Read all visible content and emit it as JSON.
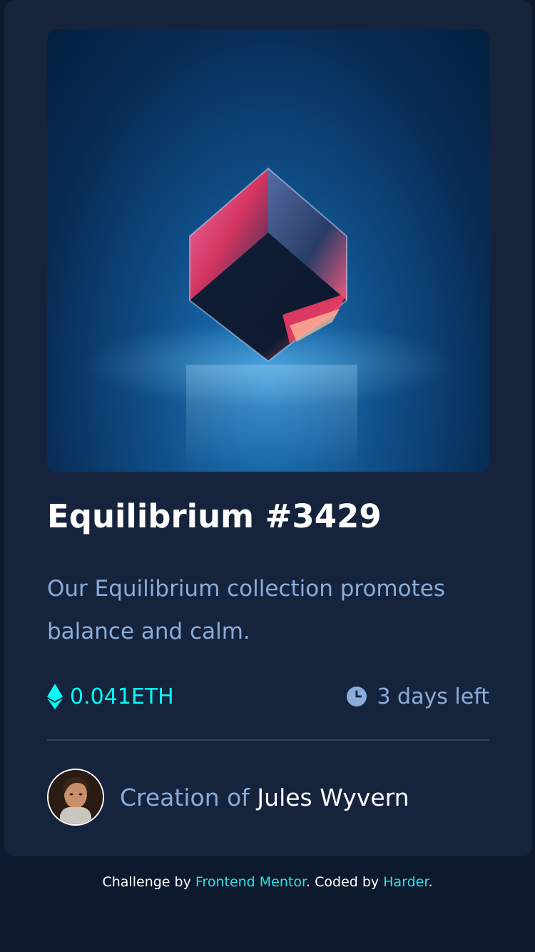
{
  "card": {
    "image_alt": "Equilibrium crystal cube",
    "title": "Equilibrium #3429",
    "description": "Our Equilibrium collection promotes balance and calm.",
    "price": "0.041ETH",
    "time_left": "3 days left",
    "creator_prefix": "Creation of",
    "creator_name": "Jules Wyvern"
  },
  "footer": {
    "challenge_by": "Challenge by",
    "frontend_mentor": "Frontend Mentor",
    "separator": ". Coded by",
    "coder": "Harder",
    "end": "."
  },
  "colors": {
    "background": "#0d192c",
    "card": "#15243c",
    "accent_cyan": "#00fff7",
    "soft_blue": "#8bacd9",
    "white": "#ffffff"
  },
  "icons": {
    "price": "ethereum-icon",
    "time": "clock-icon"
  }
}
